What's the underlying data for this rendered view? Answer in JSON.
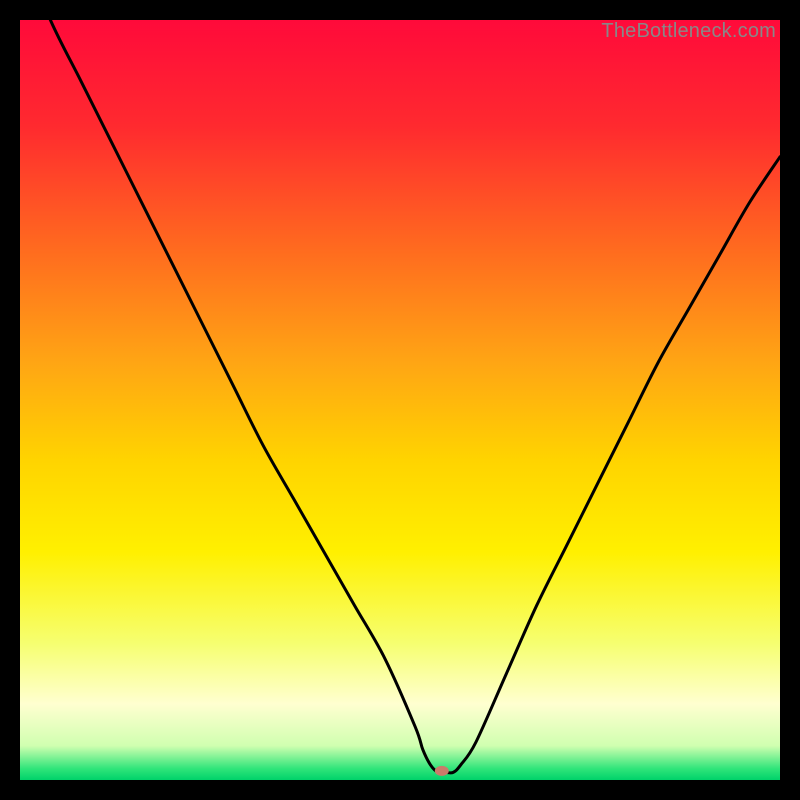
{
  "attribution": "TheBottleneck.com",
  "chart_data": {
    "type": "line",
    "title": "",
    "xlabel": "",
    "ylabel": "",
    "xlim": [
      0,
      100
    ],
    "ylim": [
      0,
      100
    ],
    "gradient_stops": [
      {
        "offset": 0.0,
        "color": "#ff0a3a"
      },
      {
        "offset": 0.14,
        "color": "#ff2a2f"
      },
      {
        "offset": 0.3,
        "color": "#ff6a1f"
      },
      {
        "offset": 0.45,
        "color": "#ffa514"
      },
      {
        "offset": 0.58,
        "color": "#ffd400"
      },
      {
        "offset": 0.7,
        "color": "#fff000"
      },
      {
        "offset": 0.82,
        "color": "#f6ff70"
      },
      {
        "offset": 0.9,
        "color": "#ffffd0"
      },
      {
        "offset": 0.955,
        "color": "#d0ffb0"
      },
      {
        "offset": 0.985,
        "color": "#30e57a"
      },
      {
        "offset": 1.0,
        "color": "#00d26a"
      }
    ],
    "series": [
      {
        "name": "bottleneck-curve",
        "x": [
          0,
          4,
          8,
          12,
          16,
          20,
          24,
          28,
          32,
          36,
          40,
          44,
          48,
          52,
          53,
          54,
          55,
          56,
          57,
          58,
          60,
          64,
          68,
          72,
          76,
          80,
          84,
          88,
          92,
          96,
          100
        ],
        "values": [
          110,
          100,
          92,
          84,
          76,
          68,
          60,
          52,
          44,
          37,
          30,
          23,
          16,
          7,
          4,
          2,
          1,
          1,
          1,
          2,
          5,
          14,
          23,
          31,
          39,
          47,
          55,
          62,
          69,
          76,
          82
        ]
      }
    ],
    "marker": {
      "x": 55.5,
      "y": 1.2,
      "color": "#c97b6a",
      "rx": 7,
      "ry": 5
    }
  }
}
